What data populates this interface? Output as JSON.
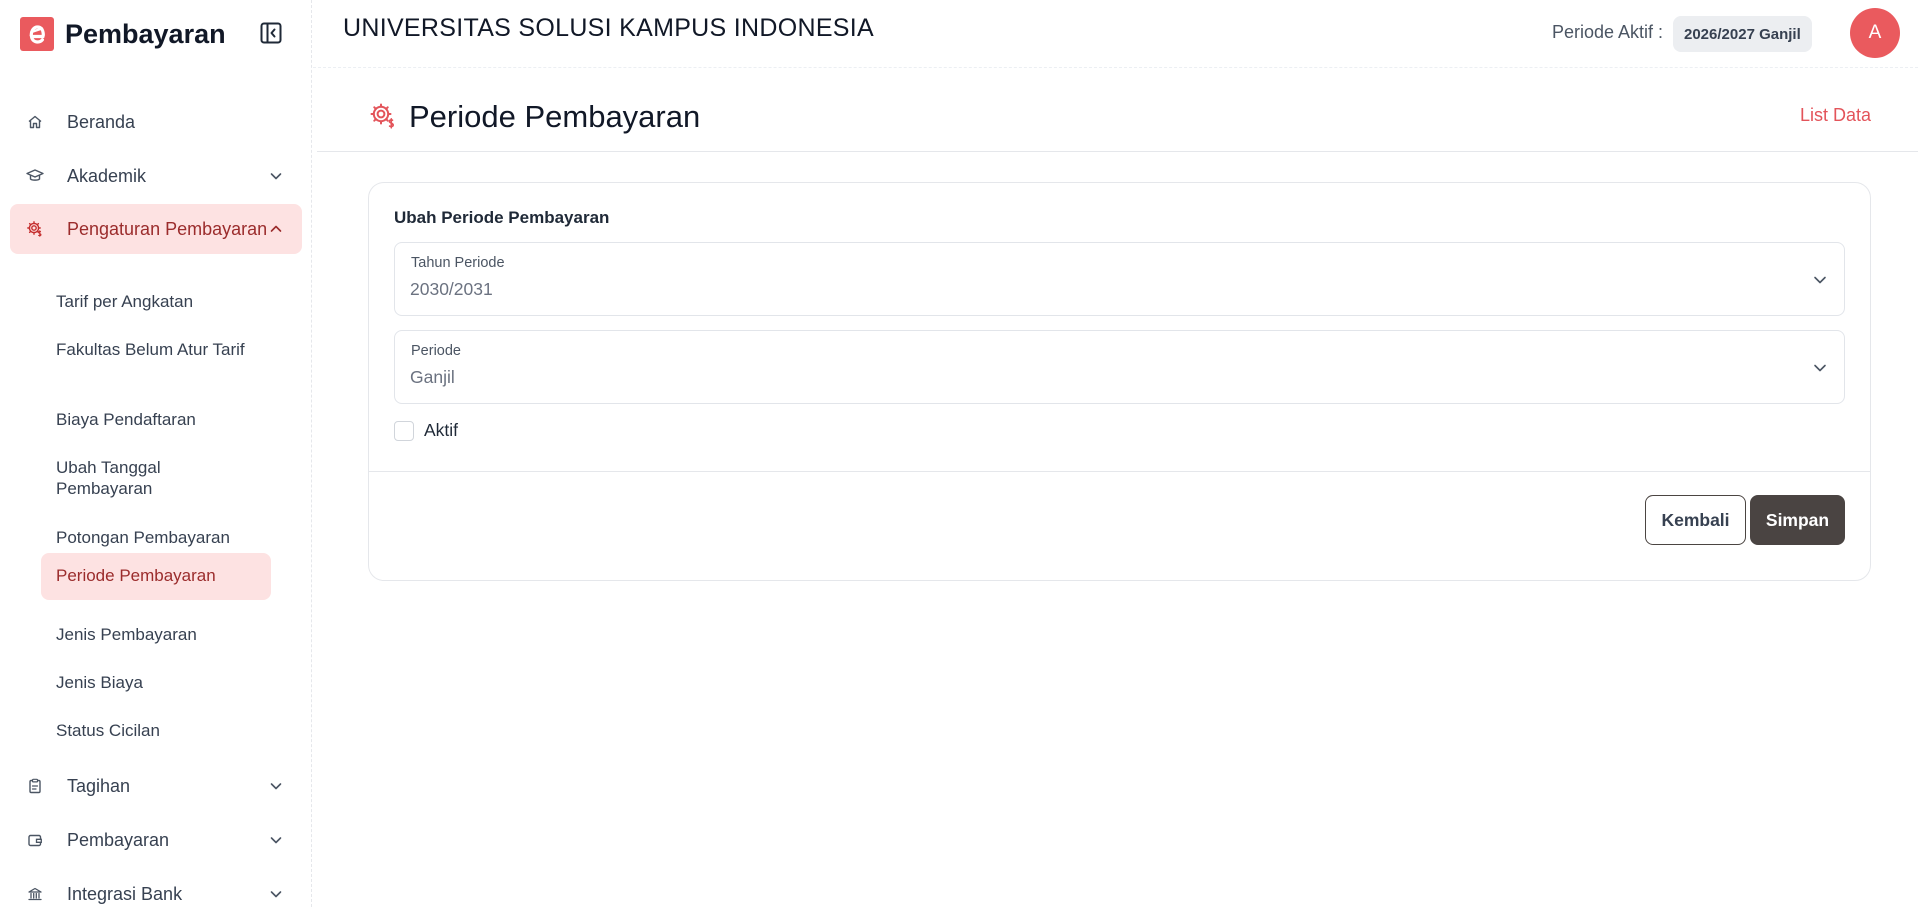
{
  "brand": {
    "name": "Pembayaran",
    "logo_icon": "logo-e-icon",
    "accent": "#ea5a5e"
  },
  "header": {
    "university": "UNIVERSITAS SOLUSI KAMPUS INDONESIA",
    "active_period_label": "Periode Aktif :",
    "active_period_value": "2026/2027 Ganjil",
    "avatar_initial": "A"
  },
  "sidebar": {
    "items": [
      {
        "label": "Beranda",
        "icon": "home-icon",
        "expandable": false,
        "active": false
      },
      {
        "label": "Akademik",
        "icon": "graduation-cap-icon",
        "expandable": true,
        "active": false
      },
      {
        "label": "Pengaturan Pembayaran",
        "icon": "gear-money-icon",
        "expandable": true,
        "expanded": true,
        "active": true
      },
      {
        "label": "Tagihan",
        "icon": "clipboard-icon",
        "expandable": true,
        "active": false
      },
      {
        "label": "Pembayaran",
        "icon": "wallet-icon",
        "expandable": true,
        "active": false
      },
      {
        "label": "Integrasi Bank",
        "icon": "bank-icon",
        "expandable": true,
        "active": false
      }
    ],
    "subitems": [
      {
        "label": "Tarif per Angkatan"
      },
      {
        "label": "Fakultas Belum Atur Tarif"
      },
      {
        "label": "Biaya Pendaftaran"
      },
      {
        "label": "Ubah Tanggal Pembayaran"
      },
      {
        "label": "Potongan Pembayaran"
      },
      {
        "label": "Periode Pembayaran",
        "active": true
      },
      {
        "label": "Jenis Pembayaran"
      },
      {
        "label": "Jenis Biaya"
      },
      {
        "label": "Status Cicilan"
      }
    ]
  },
  "page": {
    "title": "Periode Pembayaran",
    "icon": "gear-money-icon",
    "list_link": "List Data"
  },
  "form": {
    "title": "Ubah Periode Pembayaran",
    "fields": [
      {
        "label": "Tahun Periode",
        "value": "2030/2031"
      },
      {
        "label": "Periode",
        "value": "Ganjil"
      }
    ],
    "checkbox_label": "Aktif",
    "checkbox_checked": false,
    "back_label": "Kembali",
    "save_label": "Simpan"
  },
  "colors": {
    "accent": "#ea5a5e",
    "active_bg": "#fde2e2",
    "active_text": "#9b2c2c",
    "primary_button": "#4a4442"
  }
}
